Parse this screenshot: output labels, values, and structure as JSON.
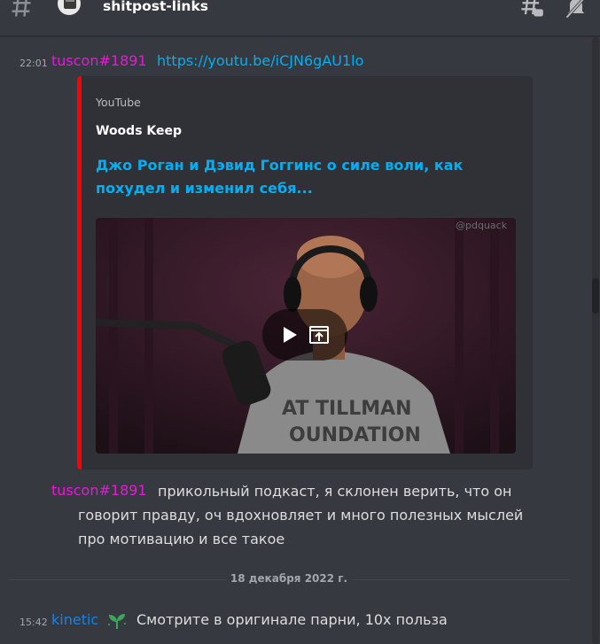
{
  "header": {
    "channel_name": "shitpost-links",
    "icons": [
      "hash-icon",
      "server-icon",
      "threads-icon",
      "mute-icon"
    ]
  },
  "messages": [
    {
      "time": "22:01",
      "author": "tuscon#1891",
      "link": "https://youtu.be/iCJN6gAU1lo",
      "embed": {
        "provider": "YouTube",
        "author": "Woods Keep",
        "title": "Джо Роган и Дэвид Гоггинс   о силе воли, как похудел и изменил себя...",
        "video_watermark": "@pdquack",
        "shirt_text_1": "AT TILLMAN",
        "shirt_text_2": "OUNDATION",
        "accent_color": "#ff0000"
      }
    },
    {
      "author": "tuscon#1891",
      "text": "прикольный подкаст, я склонен верить, что он говорит правду, оч вдохновляет и много полезных мыслей про мотивацию и все такое"
    }
  ],
  "date_divider": "18 декабря 2022 г.",
  "last_message": {
    "time": "15:42",
    "author": "kinetic",
    "text": "Смотрите в оригинале парни, 10х польза"
  },
  "colors": {
    "username_tuscon": "#e61ad6",
    "username_kinetic": "#1a82e2",
    "link": "#00aff4",
    "background": "#36393f"
  }
}
